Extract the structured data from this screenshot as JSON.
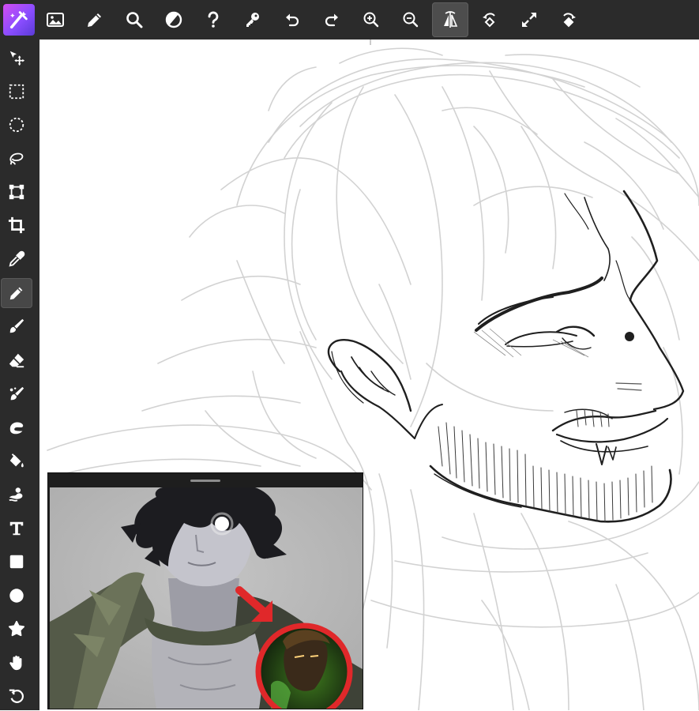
{
  "toolbar": {
    "logo": {
      "icon": "app-logo-icon",
      "accent": "#c94cf2"
    },
    "buttons": [
      {
        "id": "image",
        "icon": "image-icon"
      },
      {
        "id": "pencil",
        "icon": "pencil-icon"
      },
      {
        "id": "search",
        "icon": "search-icon"
      },
      {
        "id": "adjust",
        "icon": "contrast-icon"
      },
      {
        "id": "help",
        "icon": "help-icon"
      },
      {
        "id": "key",
        "icon": "key-icon"
      },
      {
        "id": "undo",
        "icon": "undo-icon"
      },
      {
        "id": "redo",
        "icon": "redo-icon"
      },
      {
        "id": "zoom-in",
        "icon": "zoom-in-icon"
      },
      {
        "id": "zoom-out",
        "icon": "zoom-out-icon"
      },
      {
        "id": "flip",
        "icon": "flip-icon",
        "active": true
      },
      {
        "id": "rotate-left",
        "icon": "rotate-left-icon"
      },
      {
        "id": "fullscreen",
        "icon": "fullscreen-icon"
      },
      {
        "id": "rotate-right",
        "icon": "rotate-right-icon"
      }
    ]
  },
  "tools": [
    {
      "id": "move",
      "icon": "move-icon"
    },
    {
      "id": "rect-select",
      "icon": "rect-select-icon"
    },
    {
      "id": "ellipse-select",
      "icon": "ellipse-select-icon"
    },
    {
      "id": "lasso",
      "icon": "lasso-icon"
    },
    {
      "id": "transform",
      "icon": "transform-icon"
    },
    {
      "id": "crop",
      "icon": "crop-icon"
    },
    {
      "id": "eyedropper",
      "icon": "eyedropper-icon"
    },
    {
      "id": "pencil",
      "icon": "pencil-icon",
      "active": true
    },
    {
      "id": "brush",
      "icon": "brush-icon"
    },
    {
      "id": "eraser",
      "icon": "eraser-icon"
    },
    {
      "id": "blend",
      "icon": "blend-brush-icon"
    },
    {
      "id": "smudge",
      "icon": "smudge-icon"
    },
    {
      "id": "fill",
      "icon": "paint-bucket-icon"
    },
    {
      "id": "clone",
      "icon": "clone-stamp-icon"
    },
    {
      "id": "text",
      "icon": "text-icon"
    },
    {
      "id": "rectangle",
      "icon": "rectangle-icon"
    },
    {
      "id": "ellipse",
      "icon": "ellipse-icon"
    },
    {
      "id": "shape",
      "icon": "polygon-icon"
    },
    {
      "id": "hand",
      "icon": "hand-icon"
    },
    {
      "id": "rotate",
      "icon": "rotate-view-icon"
    }
  ],
  "colors": {
    "chrome": "#2b2b2b",
    "active_tool": "#474747",
    "icon": "#ffffff",
    "sketch_light": "#cfcfcf",
    "sketch_dark": "#1f1f1f",
    "highlight_ring": "#e0282a"
  }
}
